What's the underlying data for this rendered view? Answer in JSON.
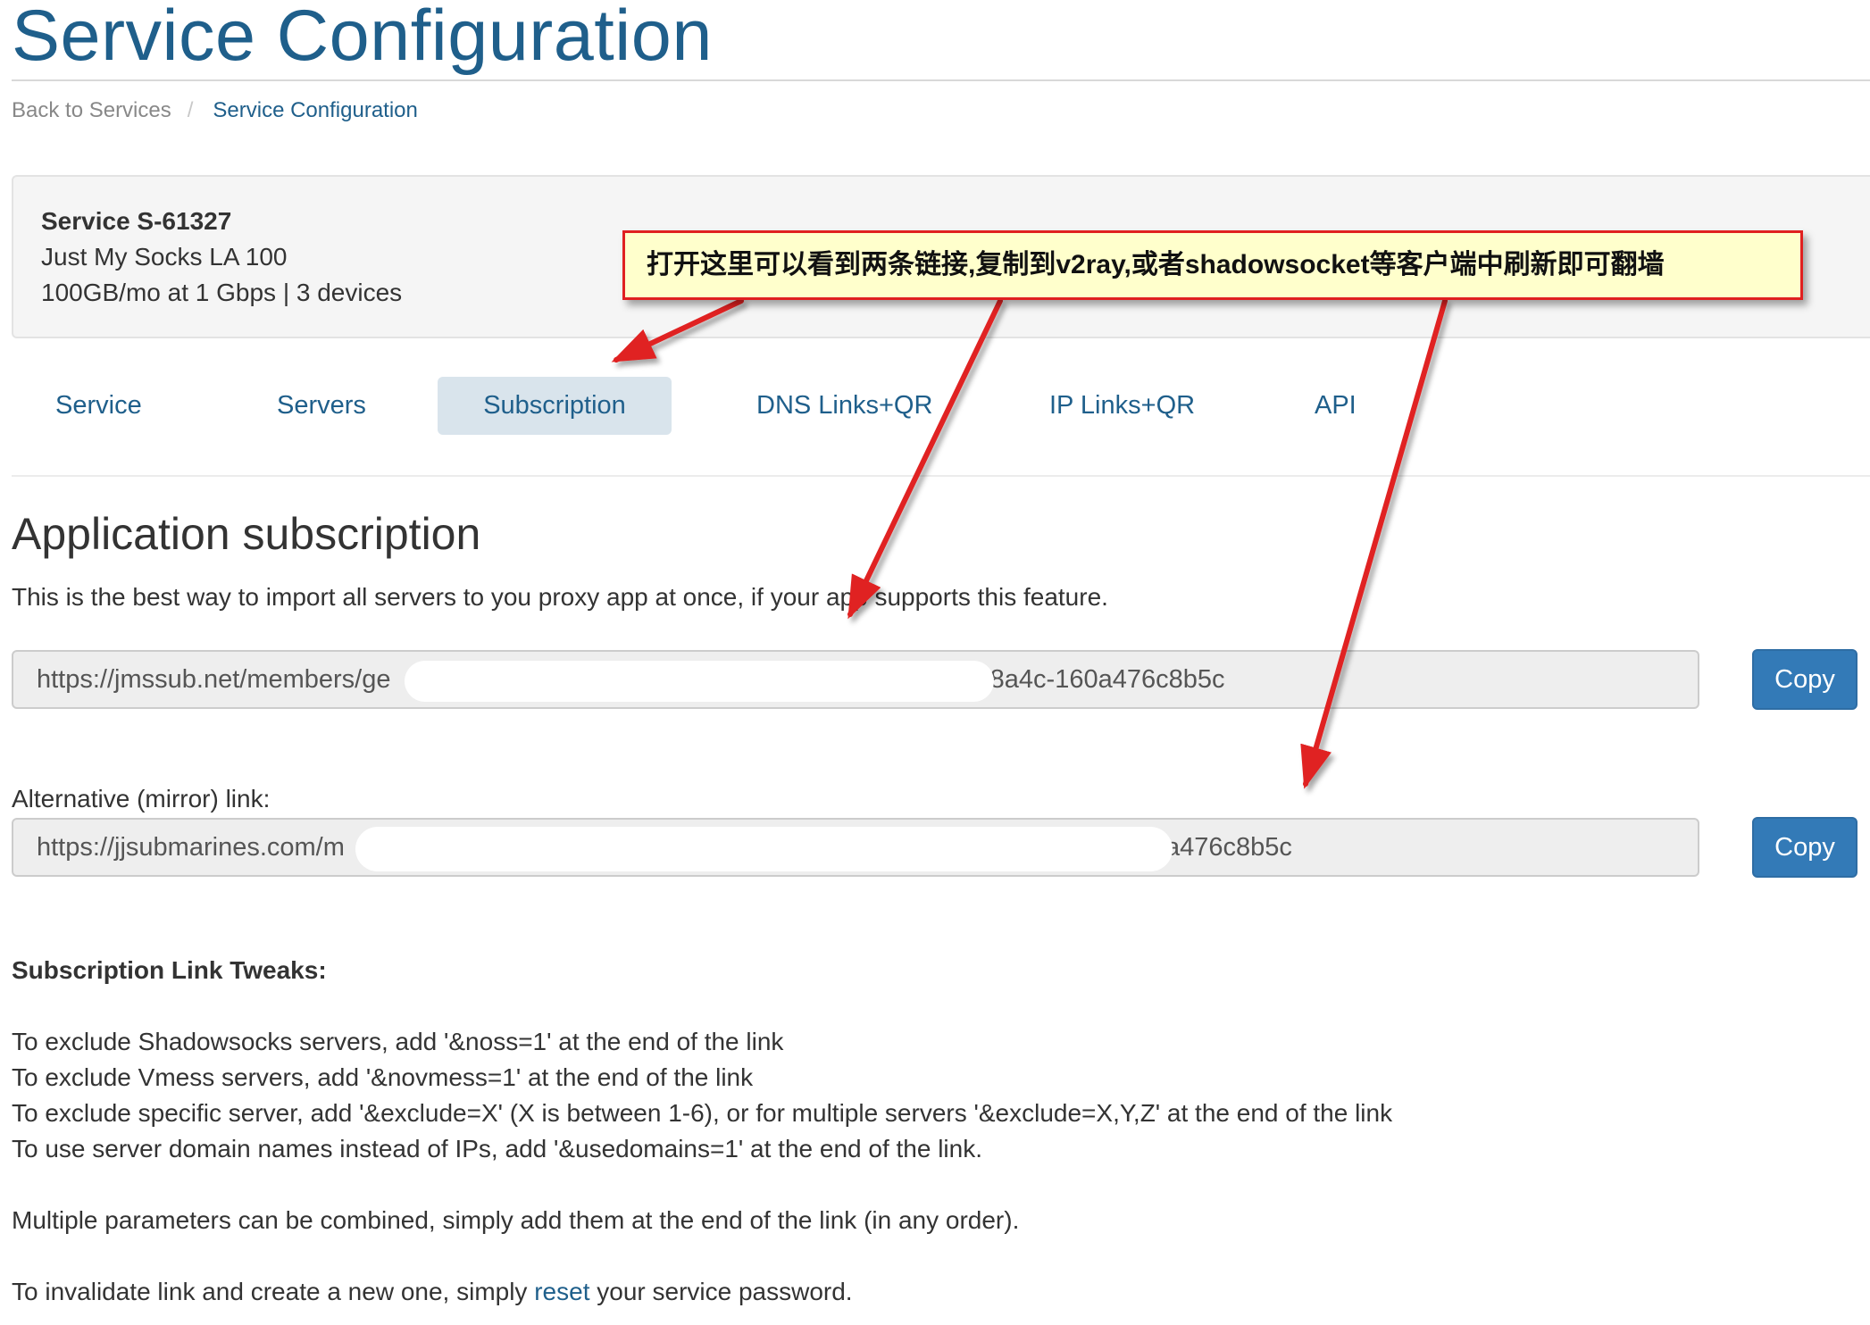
{
  "page": {
    "title": "Service Configuration"
  },
  "breadcrumb": {
    "back": "Back to Services",
    "separator": "/",
    "current": "Service Configuration"
  },
  "service": {
    "id_line": "Service S-61327",
    "plan": "Just My Socks LA 100",
    "details": "100GB/mo at 1 Gbps | 3 devices"
  },
  "tabs": [
    {
      "label": "Service",
      "active": false
    },
    {
      "label": "Servers",
      "active": false
    },
    {
      "label": "Subscription",
      "active": true
    },
    {
      "label": "DNS Links+QR",
      "active": false
    },
    {
      "label": "IP Links+QR",
      "active": false
    },
    {
      "label": "API",
      "active": false
    }
  ],
  "subscription": {
    "title": "Application subscription",
    "description": "This is the best way to import all servers to you proxy app at once, if your app supports this feature.",
    "link1": {
      "visible_start": "https://jmssub.net/members/ge",
      "visible_end": "-8a4c-160a476c8b5c"
    },
    "alt_label": "Alternative (mirror) link:",
    "link2": {
      "visible_start": "https://jjsubmarines.com/m",
      "visible_end": "a476c8b5c"
    },
    "copy_label": "Copy"
  },
  "tweaks": {
    "heading": "Subscription Link Tweaks:",
    "lines": [
      "To exclude Shadowsocks servers, add '&noss=1' at the end of the link",
      "To exclude Vmess servers, add '&novmess=1' at the end of the link",
      "To exclude specific server, add '&exclude=X' (X is between 1-6), or for multiple servers '&exclude=X,Y,Z' at the end of the link",
      "To use server domain names instead of IPs, add '&usedomains=1' at the end of the link."
    ],
    "combine": "Multiple parameters can be combined, simply add them at the end of the link (in any order).",
    "invalidate_before": "To invalidate link and create a new one, simply ",
    "invalidate_link": "reset",
    "invalidate_after": " your service password."
  },
  "annotation": {
    "text": "打开这里可以看到两条链接,复制到v2ray,或者shadowsocket等客户端中刷新即可翻墙",
    "color": "#e02020",
    "background": "#ffffcc"
  },
  "colors": {
    "link_blue": "#1f5f8b",
    "button_blue": "#337ab7",
    "active_tab_bg": "#d9e4ec"
  }
}
